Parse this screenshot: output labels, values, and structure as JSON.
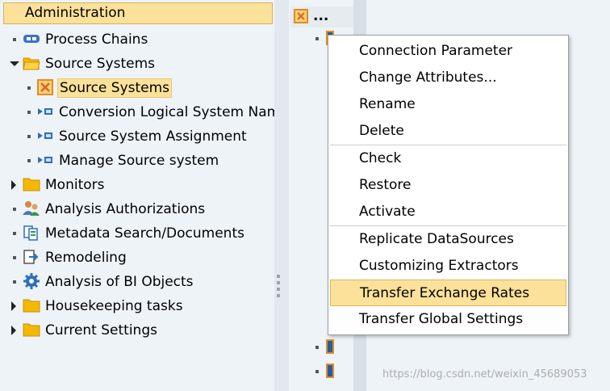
{
  "tree": {
    "header": "Administration",
    "items": [
      {
        "label": "Process Chains",
        "icon": "process-chain-icon",
        "expander": "bullet"
      },
      {
        "label": "Source Systems",
        "icon": "folder-open-icon",
        "expander": "expanded"
      },
      {
        "label": "Source Systems",
        "icon": "source-system-icon",
        "expander": "bullet",
        "selected": true
      },
      {
        "label": "Conversion Logical System Names",
        "icon": "conversion-icon",
        "expander": "bullet"
      },
      {
        "label": "Source System Assignment",
        "icon": "conversion-icon",
        "expander": "bullet"
      },
      {
        "label": "Manage Source system",
        "icon": "conversion-icon",
        "expander": "bullet"
      },
      {
        "label": "Monitors",
        "icon": "folder-icon",
        "expander": "collapsed"
      },
      {
        "label": "Analysis Authorizations",
        "icon": "users-icon",
        "expander": "bullet"
      },
      {
        "label": "Metadata Search/Documents",
        "icon": "metadata-icon",
        "expander": "bullet"
      },
      {
        "label": "Remodeling",
        "icon": "remodeling-icon",
        "expander": "bullet"
      },
      {
        "label": "Analysis of BI Objects",
        "icon": "gear-icon",
        "expander": "bullet"
      },
      {
        "label": "Housekeeping tasks",
        "icon": "folder-icon",
        "expander": "collapsed"
      },
      {
        "label": "Current Settings",
        "icon": "folder-icon",
        "expander": "collapsed"
      }
    ]
  },
  "right_pane": {
    "header_text": "..."
  },
  "context_menu": {
    "groups": [
      [
        {
          "label": "Connection Parameter"
        },
        {
          "label": "Change Attributes..."
        },
        {
          "label": "Rename"
        },
        {
          "label": "Delete"
        }
      ],
      [
        {
          "label": "Check"
        },
        {
          "label": "Restore"
        },
        {
          "label": "Activate"
        }
      ],
      [
        {
          "label": "Replicate DataSources"
        },
        {
          "label": "Customizing Extractors"
        },
        {
          "label": "Transfer Exchange Rates",
          "highlighted": true
        },
        {
          "label": "Transfer Global Settings"
        }
      ]
    ]
  },
  "watermark": "https://blog.csdn.net/weixin_45689053",
  "colors": {
    "selection": "#fbe19a",
    "pane_background": "#eef3f8",
    "folder": "#f5b800"
  }
}
